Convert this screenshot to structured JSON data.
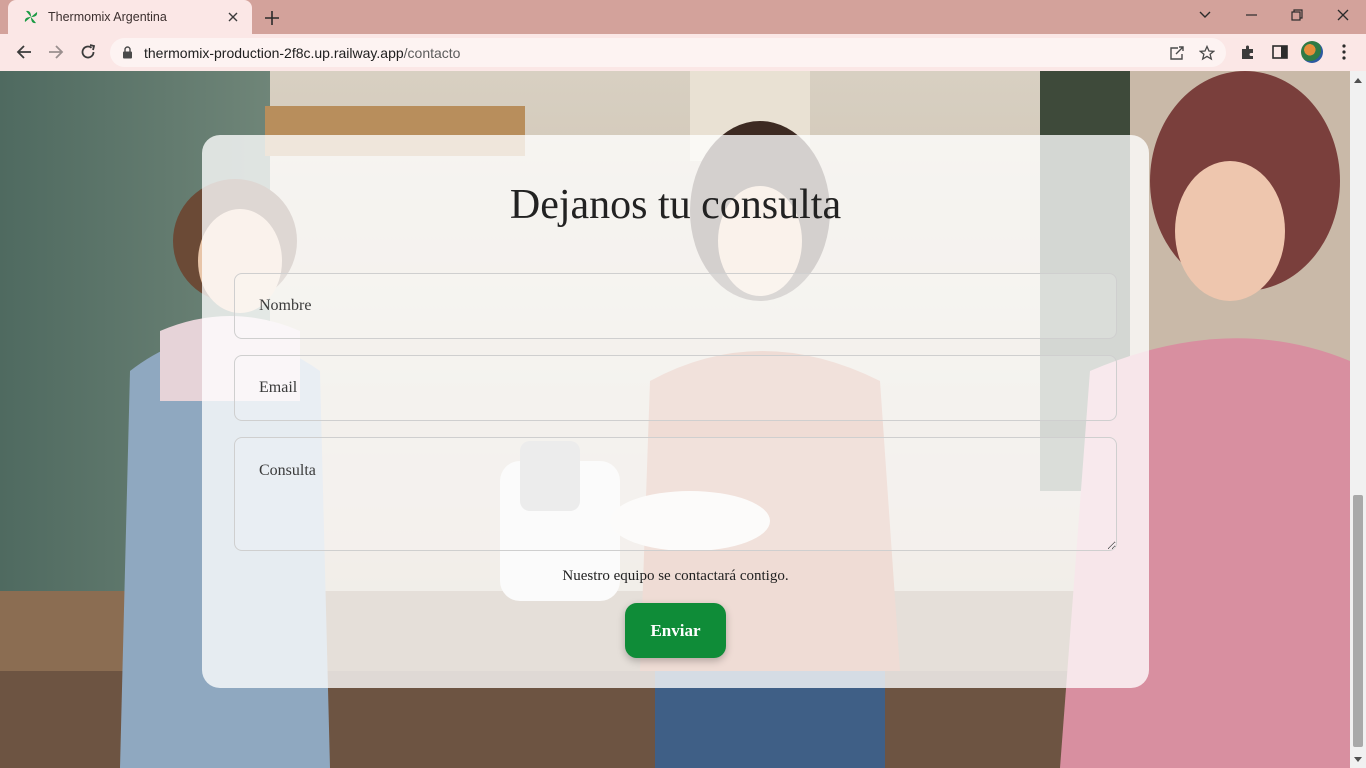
{
  "browser": {
    "tab_title": "Thermomix Argentina",
    "url_host": "thermomix-production-2f8c.up.railway.app",
    "url_path": "/contacto",
    "accent": "#d3a29b",
    "toolbar_bg": "#fbe7e6"
  },
  "icons": {
    "favicon": "thermomix-leaf-icon",
    "tab_close": "close-icon",
    "new_tab": "plus-icon",
    "back": "arrow-left-icon",
    "forward": "arrow-right-icon",
    "reload": "reload-icon",
    "lock": "lock-icon",
    "share": "share-icon",
    "bookmark": "star-icon",
    "extensions": "puzzle-icon",
    "side_panel": "side-panel-icon",
    "profile": "avatar",
    "menu": "kebab-menu-icon"
  },
  "form": {
    "title": "Dejanos tu consulta",
    "name_placeholder": "Nombre",
    "email_placeholder": "Email",
    "message_placeholder": "Consulta",
    "note": "Nuestro equipo se contactará contigo.",
    "submit_label": "Enviar",
    "submit_color": "#0f8c38"
  }
}
